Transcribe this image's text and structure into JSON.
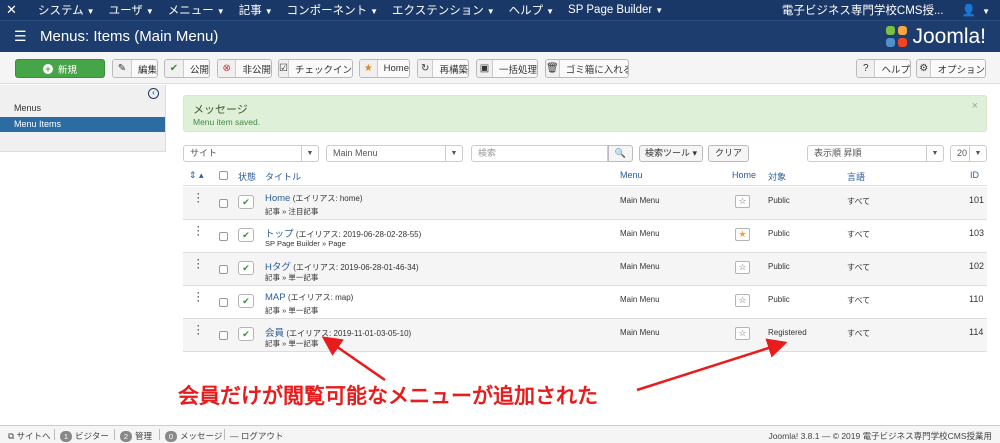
{
  "topnav": {
    "menus": [
      "システム",
      "ユーザ",
      "メニュー",
      "記事",
      "コンポーネント",
      "エクステンション",
      "ヘルプ",
      "SP Page Builder"
    ],
    "site_name": "電子ビジネス専門学校CMS授...",
    "user_icon": "user-icon"
  },
  "header": {
    "title": "Menus: Items (Main Menu)",
    "logo_text": "Joomla!"
  },
  "toolbar": {
    "new": "新規",
    "edit": "編集",
    "publish": "公開",
    "unpublish": "非公開",
    "checkin": "チェックイン",
    "home": "Home",
    "rebuild": "再構築",
    "batch": "一括処理",
    "trash": "ゴミ箱に入れる",
    "help": "ヘルプ",
    "options": "オプション"
  },
  "sidebar": {
    "items": [
      {
        "label": "Menus"
      },
      {
        "label": "Menu Items"
      }
    ]
  },
  "message": {
    "heading": "メッセージ",
    "text": "Menu item saved."
  },
  "filters": {
    "site": "サイト",
    "menu": "Main Menu",
    "search_placeholder": "検索",
    "search_tools": "検索ツール",
    "clear": "クリア",
    "sort": "表示順 昇順",
    "limit": "20"
  },
  "table": {
    "headers": {
      "status": "状態",
      "title": "タイトル",
      "menu": "Menu",
      "home": "Home",
      "access": "対象",
      "language": "言語",
      "id": "ID"
    },
    "rows": [
      {
        "title": "Home",
        "alias": "(エイリアス: home)",
        "sub": "記事 » 注目記事",
        "menu": "Main Menu",
        "home": false,
        "access": "Public",
        "language": "すべて",
        "id": "101"
      },
      {
        "title": "トップ",
        "alias": "(エイリアス: 2019-06-28-02-28-55)",
        "sub": "SP Page Builder » Page",
        "menu": "Main Menu",
        "home": true,
        "access": "Public",
        "language": "すべて",
        "id": "103"
      },
      {
        "title": "Hタグ",
        "alias": "(エイリアス: 2019-06-28-01-46-34)",
        "sub": "記事 » 単一記事",
        "menu": "Main Menu",
        "home": false,
        "access": "Public",
        "language": "すべて",
        "id": "102"
      },
      {
        "title": "MAP",
        "alias": "(エイリアス: map)",
        "sub": "記事 » 単一記事",
        "menu": "Main Menu",
        "home": false,
        "access": "Public",
        "language": "すべて",
        "id": "110"
      },
      {
        "title": "会員",
        "alias": "(エイリアス: 2019-11-01-03-05-10)",
        "sub": "記事 » 単一記事",
        "menu": "Main Menu",
        "home": false,
        "access": "Registered",
        "language": "すべて",
        "id": "114"
      }
    ]
  },
  "annotation": {
    "text": "会員だけが閲覧可能なメニューが追加された",
    "color": "#e81c1c"
  },
  "statusbar": {
    "view_site": "サイトへ",
    "visitors_count": "1",
    "visitors": "ビジター",
    "admins_count": "2",
    "admins": "管理",
    "messages_count": "0",
    "messages": "メッセージ",
    "logout": "ログアウト",
    "version": "Joomla! 3.8.1 — © 2019 電子ビジネス専門学校CMS授業用"
  }
}
